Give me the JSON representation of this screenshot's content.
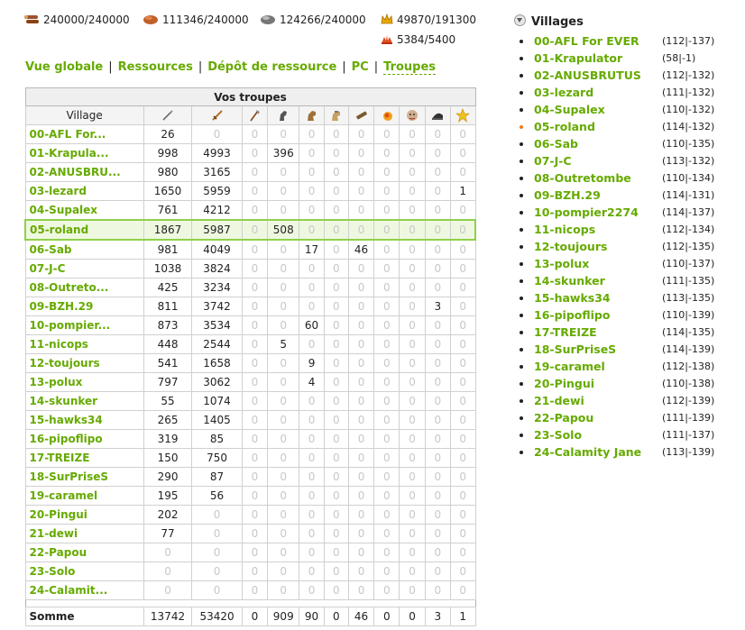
{
  "resources": {
    "wood": {
      "value": "240000/240000",
      "icon": "wood-icon"
    },
    "clay": {
      "value": "111346/240000",
      "icon": "clay-icon"
    },
    "iron": {
      "value": "124266/240000",
      "icon": "iron-icon"
    },
    "food": {
      "value": "49870/191300",
      "icon": "crown-icon"
    },
    "troops": {
      "value": "5384/5400",
      "icon": "population-icon"
    }
  },
  "nav": {
    "overview": "Vue globale",
    "resources": "Ressources",
    "depot": "Dépôt de ressource",
    "pc": "PC",
    "troops": "Troupes",
    "separator": "|"
  },
  "table": {
    "title": "Vos troupes",
    "village_header": "Village",
    "unit_icons": [
      "spear-icon",
      "sword-icon",
      "axe-icon",
      "scout-icon",
      "light-cavalry-icon",
      "heavy-cavalry-icon",
      "ram-icon",
      "catapult-icon",
      "knight-icon",
      "snob-icon",
      "star-icon"
    ],
    "rows": [
      {
        "name": "00-AFL For...",
        "vals": [
          "26",
          "0",
          "0",
          "0",
          "0",
          "0",
          "0",
          "0",
          "0",
          "0",
          "0"
        ]
      },
      {
        "name": "01-Krapula...",
        "vals": [
          "998",
          "4993",
          "0",
          "396",
          "0",
          "0",
          "0",
          "0",
          "0",
          "0",
          "0"
        ]
      },
      {
        "name": "02-ANUSBRU...",
        "vals": [
          "980",
          "3165",
          "0",
          "0",
          "0",
          "0",
          "0",
          "0",
          "0",
          "0",
          "0"
        ]
      },
      {
        "name": "03-lezard",
        "vals": [
          "1650",
          "5959",
          "0",
          "0",
          "0",
          "0",
          "0",
          "0",
          "0",
          "0",
          "1"
        ]
      },
      {
        "name": "04-Supalex",
        "vals": [
          "761",
          "4212",
          "0",
          "0",
          "0",
          "0",
          "0",
          "0",
          "0",
          "0",
          "0"
        ]
      },
      {
        "name": "05-roland",
        "vals": [
          "1867",
          "5987",
          "0",
          "508",
          "0",
          "0",
          "0",
          "0",
          "0",
          "0",
          "0"
        ],
        "selected": true
      },
      {
        "name": "06-Sab",
        "vals": [
          "981",
          "4049",
          "0",
          "0",
          "17",
          "0",
          "46",
          "0",
          "0",
          "0",
          "0"
        ]
      },
      {
        "name": "07-J-C",
        "vals": [
          "1038",
          "3824",
          "0",
          "0",
          "0",
          "0",
          "0",
          "0",
          "0",
          "0",
          "0"
        ]
      },
      {
        "name": "08-Outreto...",
        "vals": [
          "425",
          "3234",
          "0",
          "0",
          "0",
          "0",
          "0",
          "0",
          "0",
          "0",
          "0"
        ]
      },
      {
        "name": "09-BZH.29",
        "vals": [
          "811",
          "3742",
          "0",
          "0",
          "0",
          "0",
          "0",
          "0",
          "0",
          "3",
          "0"
        ]
      },
      {
        "name": "10-pompier...",
        "vals": [
          "873",
          "3534",
          "0",
          "0",
          "60",
          "0",
          "0",
          "0",
          "0",
          "0",
          "0"
        ]
      },
      {
        "name": "11-nicops",
        "vals": [
          "448",
          "2544",
          "0",
          "5",
          "0",
          "0",
          "0",
          "0",
          "0",
          "0",
          "0"
        ]
      },
      {
        "name": "12-toujours",
        "vals": [
          "541",
          "1658",
          "0",
          "0",
          "9",
          "0",
          "0",
          "0",
          "0",
          "0",
          "0"
        ]
      },
      {
        "name": "13-polux",
        "vals": [
          "797",
          "3062",
          "0",
          "0",
          "4",
          "0",
          "0",
          "0",
          "0",
          "0",
          "0"
        ]
      },
      {
        "name": "14-skunker",
        "vals": [
          "55",
          "1074",
          "0",
          "0",
          "0",
          "0",
          "0",
          "0",
          "0",
          "0",
          "0"
        ]
      },
      {
        "name": "15-hawks34",
        "vals": [
          "265",
          "1405",
          "0",
          "0",
          "0",
          "0",
          "0",
          "0",
          "0",
          "0",
          "0"
        ]
      },
      {
        "name": "16-pipoflipo",
        "vals": [
          "319",
          "85",
          "0",
          "0",
          "0",
          "0",
          "0",
          "0",
          "0",
          "0",
          "0"
        ]
      },
      {
        "name": "17-TREIZE",
        "vals": [
          "150",
          "750",
          "0",
          "0",
          "0",
          "0",
          "0",
          "0",
          "0",
          "0",
          "0"
        ]
      },
      {
        "name": "18-SurPriseS",
        "vals": [
          "290",
          "87",
          "0",
          "0",
          "0",
          "0",
          "0",
          "0",
          "0",
          "0",
          "0"
        ]
      },
      {
        "name": "19-caramel",
        "vals": [
          "195",
          "56",
          "0",
          "0",
          "0",
          "0",
          "0",
          "0",
          "0",
          "0",
          "0"
        ]
      },
      {
        "name": "20-Pingui",
        "vals": [
          "202",
          "0",
          "0",
          "0",
          "0",
          "0",
          "0",
          "0",
          "0",
          "0",
          "0"
        ]
      },
      {
        "name": "21-dewi",
        "vals": [
          "77",
          "0",
          "0",
          "0",
          "0",
          "0",
          "0",
          "0",
          "0",
          "0",
          "0"
        ]
      },
      {
        "name": "22-Papou",
        "vals": [
          "0",
          "0",
          "0",
          "0",
          "0",
          "0",
          "0",
          "0",
          "0",
          "0",
          "0"
        ]
      },
      {
        "name": "23-Solo",
        "vals": [
          "0",
          "0",
          "0",
          "0",
          "0",
          "0",
          "0",
          "0",
          "0",
          "0",
          "0"
        ]
      },
      {
        "name": "24-Calamit...",
        "vals": [
          "0",
          "0",
          "0",
          "0",
          "0",
          "0",
          "0",
          "0",
          "0",
          "0",
          "0"
        ]
      }
    ],
    "total": {
      "label": "Somme",
      "vals": [
        "13742",
        "53420",
        "0",
        "909",
        "90",
        "0",
        "46",
        "0",
        "0",
        "3",
        "1"
      ]
    }
  },
  "villages": {
    "title": "Villages",
    "items": [
      {
        "name": "00-AFL For EVER",
        "coords": "(112|-137)"
      },
      {
        "name": "01-Krapulator",
        "coords": "(58|-1)"
      },
      {
        "name": "02-ANUSBRUTUS",
        "coords": "(112|-132)"
      },
      {
        "name": "03-lezard",
        "coords": "(111|-132)"
      },
      {
        "name": "04-Supalex",
        "coords": "(110|-132)"
      },
      {
        "name": "05-roland",
        "coords": "(114|-132)",
        "current": true
      },
      {
        "name": "06-Sab",
        "coords": "(110|-135)"
      },
      {
        "name": "07-J-C",
        "coords": "(113|-132)"
      },
      {
        "name": "08-Outretombe",
        "coords": "(110|-134)"
      },
      {
        "name": "09-BZH.29",
        "coords": "(114|-131)"
      },
      {
        "name": "10-pompier2274",
        "coords": "(114|-137)"
      },
      {
        "name": "11-nicops",
        "coords": "(112|-134)"
      },
      {
        "name": "12-toujours",
        "coords": "(112|-135)"
      },
      {
        "name": "13-polux",
        "coords": "(110|-137)"
      },
      {
        "name": "14-skunker",
        "coords": "(111|-135)"
      },
      {
        "name": "15-hawks34",
        "coords": "(113|-135)"
      },
      {
        "name": "16-pipoflipo",
        "coords": "(110|-139)"
      },
      {
        "name": "17-TREIZE",
        "coords": "(114|-135)"
      },
      {
        "name": "18-SurPriseS",
        "coords": "(114|-139)"
      },
      {
        "name": "19-caramel",
        "coords": "(112|-138)"
      },
      {
        "name": "20-Pingui",
        "coords": "(110|-138)"
      },
      {
        "name": "21-dewi",
        "coords": "(112|-139)"
      },
      {
        "name": "22-Papou",
        "coords": "(111|-139)"
      },
      {
        "name": "23-Solo",
        "coords": "(111|-137)"
      },
      {
        "name": "24-Calamity Jane",
        "coords": "(113|-139)"
      }
    ]
  },
  "colors": {
    "link": "#66aa00",
    "selected_border": "#8fd04a",
    "current_dot": "#f07a1a",
    "zero_text": "#c8c8c8"
  }
}
